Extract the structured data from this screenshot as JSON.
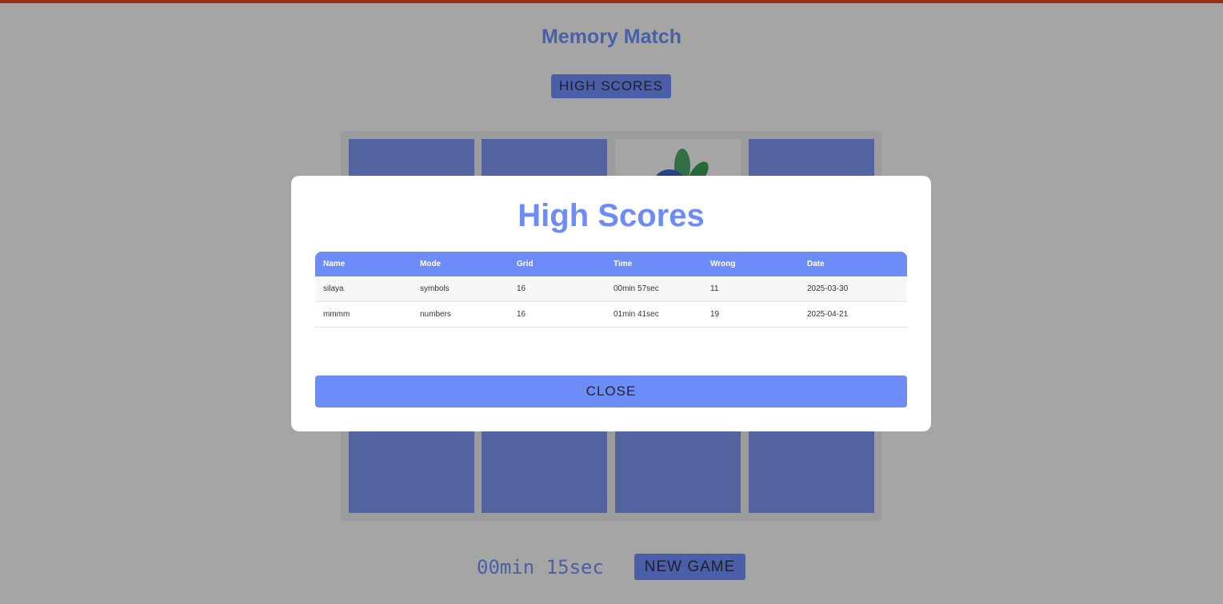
{
  "app": {
    "title": "Memory Match",
    "high_scores_button": "HIGH SCORES",
    "new_game_button": "NEW GAME",
    "timer": "00min 15sec",
    "accent_color": "#6e8cf8",
    "top_bar_color": "#e0471f"
  },
  "board": {
    "grid_size": 16,
    "revealed_card_icon": "blueberry-icon"
  },
  "modal": {
    "title": "High Scores",
    "columns": [
      "Name",
      "Mode",
      "Grid",
      "Time",
      "Wrong",
      "Date"
    ],
    "rows": [
      [
        "silaya",
        "symbols",
        "16",
        "00min 57sec",
        "11",
        "2025-03-30"
      ],
      [
        "mmmm",
        "numbers",
        "16",
        "01min 41sec",
        "19",
        "2025-04-21"
      ]
    ],
    "close_button": "CLOSE"
  }
}
